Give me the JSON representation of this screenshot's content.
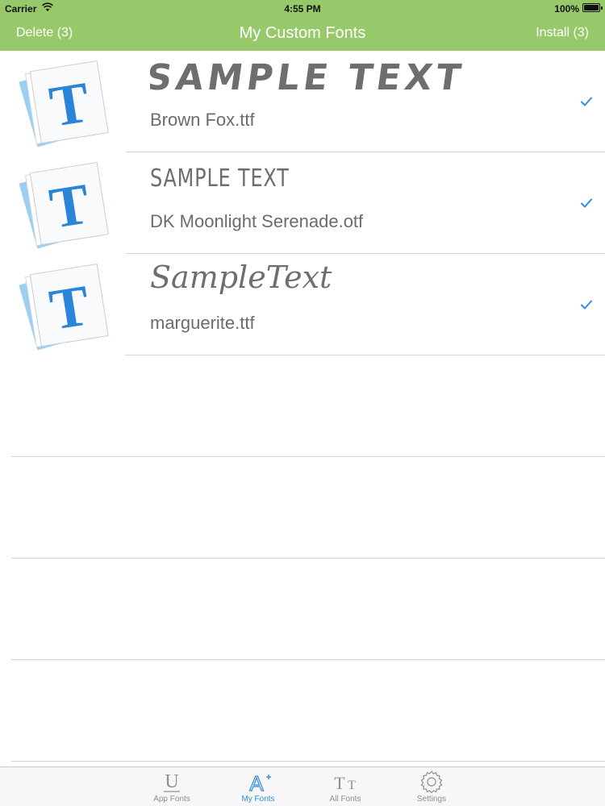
{
  "status_bar": {
    "carrier": "Carrier",
    "time": "4:55 PM",
    "battery": "100%"
  },
  "nav": {
    "left_button": "Delete (3)",
    "title": "My Custom Fonts",
    "right_button": "Install (3)"
  },
  "fonts": [
    {
      "sample": "SAMPLE TEXT",
      "file": "Brown Fox.ttf",
      "selected": true,
      "icon": "font-file-icon"
    },
    {
      "sample": "SAMPLE TEXT",
      "file": "DK Moonlight Serenade.otf",
      "selected": true,
      "icon": "font-file-icon"
    },
    {
      "sample": "SampleText",
      "file": "marguerite.ttf",
      "selected": true,
      "icon": "font-file-icon"
    }
  ],
  "tabs": [
    {
      "label": "App Fonts",
      "icon": "app-fonts-icon",
      "active": false
    },
    {
      "label": "My Fonts",
      "icon": "my-fonts-icon",
      "active": true
    },
    {
      "label": "All Fonts",
      "icon": "all-fonts-icon",
      "active": false
    },
    {
      "label": "Settings",
      "icon": "gear-icon",
      "active": false
    }
  ],
  "colors": {
    "bar_green": "#97c96a",
    "accent_blue": "#2f8de4",
    "sample_gray": "#6e6e6e"
  }
}
